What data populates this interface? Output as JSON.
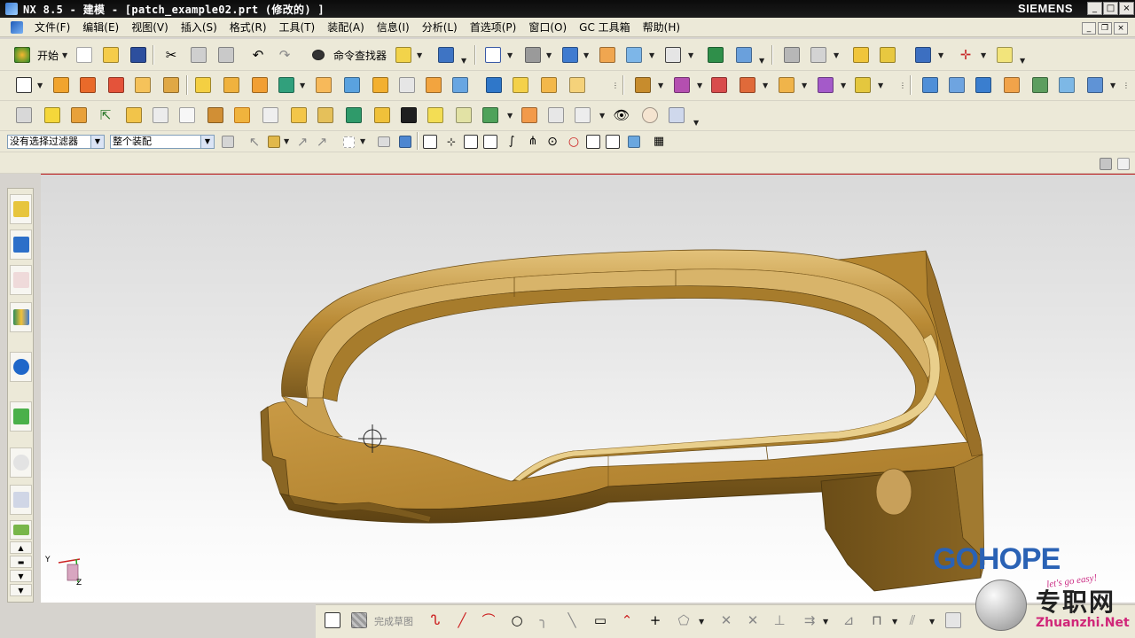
{
  "window": {
    "title": "NX 8.5 - 建模 - [patch_example02.prt (修改的) ]",
    "brand": "SIEMENS",
    "controls": {
      "minimize": "_",
      "maximize": "□",
      "close": "×"
    }
  },
  "menubar": {
    "items": [
      "文件(F)",
      "编辑(E)",
      "视图(V)",
      "插入(S)",
      "格式(R)",
      "工具(T)",
      "装配(A)",
      "信息(I)",
      "分析(L)",
      "首选项(P)",
      "窗口(O)",
      "GC 工具箱",
      "帮助(H)"
    ]
  },
  "toolbar_standard": {
    "start_label": "开始",
    "command_finder_label": "命令查找器"
  },
  "selection_bar": {
    "filter_value": "没有选择过滤器",
    "scope_value": "整个装配"
  },
  "sketch_bar": {
    "finish_sketch_label": "完成草图"
  },
  "triad": {
    "x_label": "Y",
    "z_label": "Z"
  },
  "watermark": {
    "logo": "GOHOPE",
    "slogan": "let's go easy!",
    "cn": "专职网",
    "url": "Zhuanzhi.Net"
  },
  "colors": {
    "part": "#b98a35",
    "part_dark": "#6e4f17",
    "part_light": "#dcb86b",
    "accent_blue": "#2a62b5",
    "accent_pink": "#d02779"
  }
}
